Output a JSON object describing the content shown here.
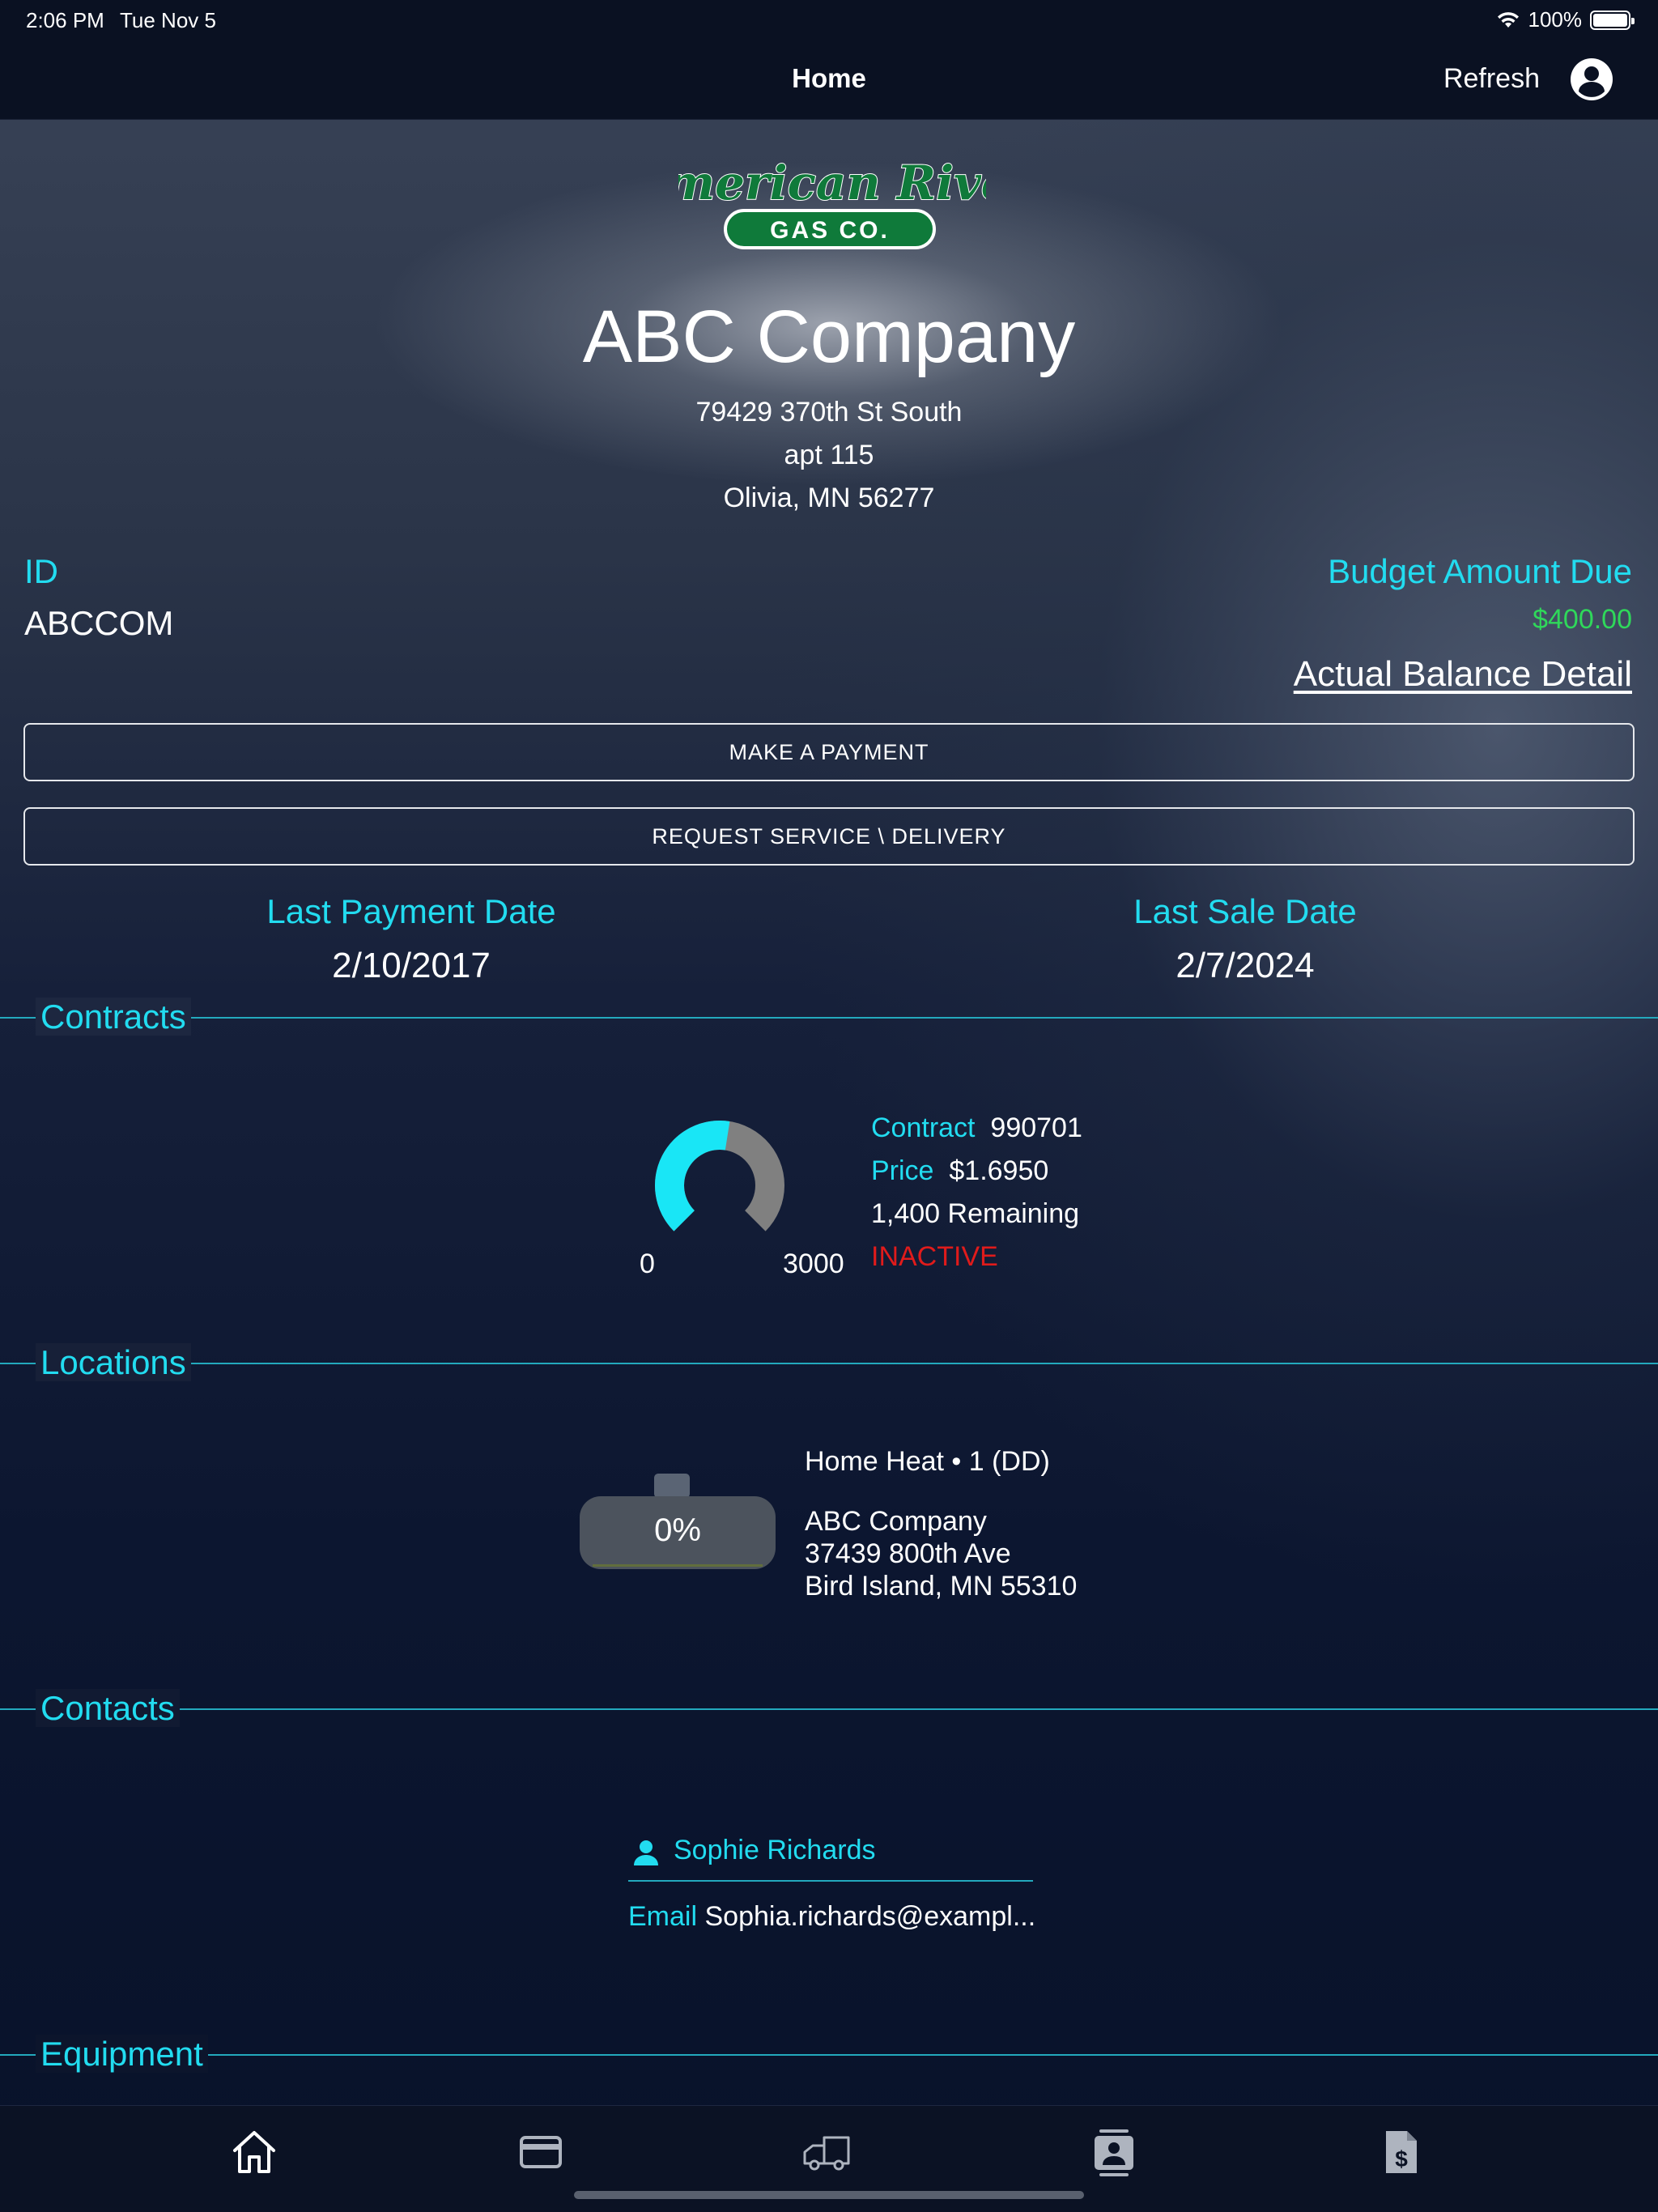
{
  "status_bar": {
    "time": "2:06 PM",
    "date": "Tue Nov 5",
    "battery": "100%"
  },
  "nav": {
    "title": "Home",
    "refresh_label": "Refresh"
  },
  "logo": {
    "brand_script": "American River",
    "brand_sub": "GAS CO.",
    "colors": {
      "green": "#0f7a3a",
      "dark_green": "#0b5e2a"
    }
  },
  "company": {
    "name": "ABC Company",
    "address_line1": "79429 370th St South",
    "address_line2": "apt 115",
    "address_line3": "Olivia, MN 56277"
  },
  "account": {
    "id_label": "ID",
    "id_value": "ABCCOM",
    "budget_label": "Budget Amount Due",
    "budget_value": "$400.00",
    "balance_link": "Actual Balance Detail"
  },
  "actions": {
    "make_payment": "MAKE A PAYMENT",
    "request_service": "REQUEST SERVICE \\ DELIVERY"
  },
  "dates": {
    "last_payment_label": "Last Payment Date",
    "last_payment_value": "2/10/2017",
    "last_sale_label": "Last Sale Date",
    "last_sale_value": "2/7/2024"
  },
  "sections": {
    "contracts": "Contracts",
    "locations": "Locations",
    "contacts": "Contacts",
    "equipment": "Equipment"
  },
  "contract": {
    "gauge_min": "0",
    "gauge_max": "3000",
    "gauge_fraction_used": 0.533,
    "contract_label": "Contract",
    "contract_value": "990701",
    "price_label": "Price",
    "price_value": "$1.6950",
    "remaining": "1,400 Remaining",
    "status": "INACTIVE"
  },
  "location": {
    "tank_percent": "0%",
    "tank_level": 0,
    "title": "Home Heat • 1 (DD)",
    "name": "ABC Company",
    "street": "37439 800th Ave",
    "city": "Bird Island, MN  55310"
  },
  "contact": {
    "name": "Sophie Richards",
    "email_label": "Email",
    "email_value": "Sophia.richards@exampl..."
  },
  "tabs": [
    {
      "icon": "home-icon"
    },
    {
      "icon": "credit-card-icon"
    },
    {
      "icon": "delivery-truck-icon"
    },
    {
      "icon": "contact-card-icon"
    },
    {
      "icon": "invoice-dollar-icon"
    }
  ],
  "theme": {
    "accent_cyan": "#22dcf0",
    "money_green": "#2fd85a",
    "inactive_red": "#e01b1b",
    "gauge_gray": "#808080"
  }
}
